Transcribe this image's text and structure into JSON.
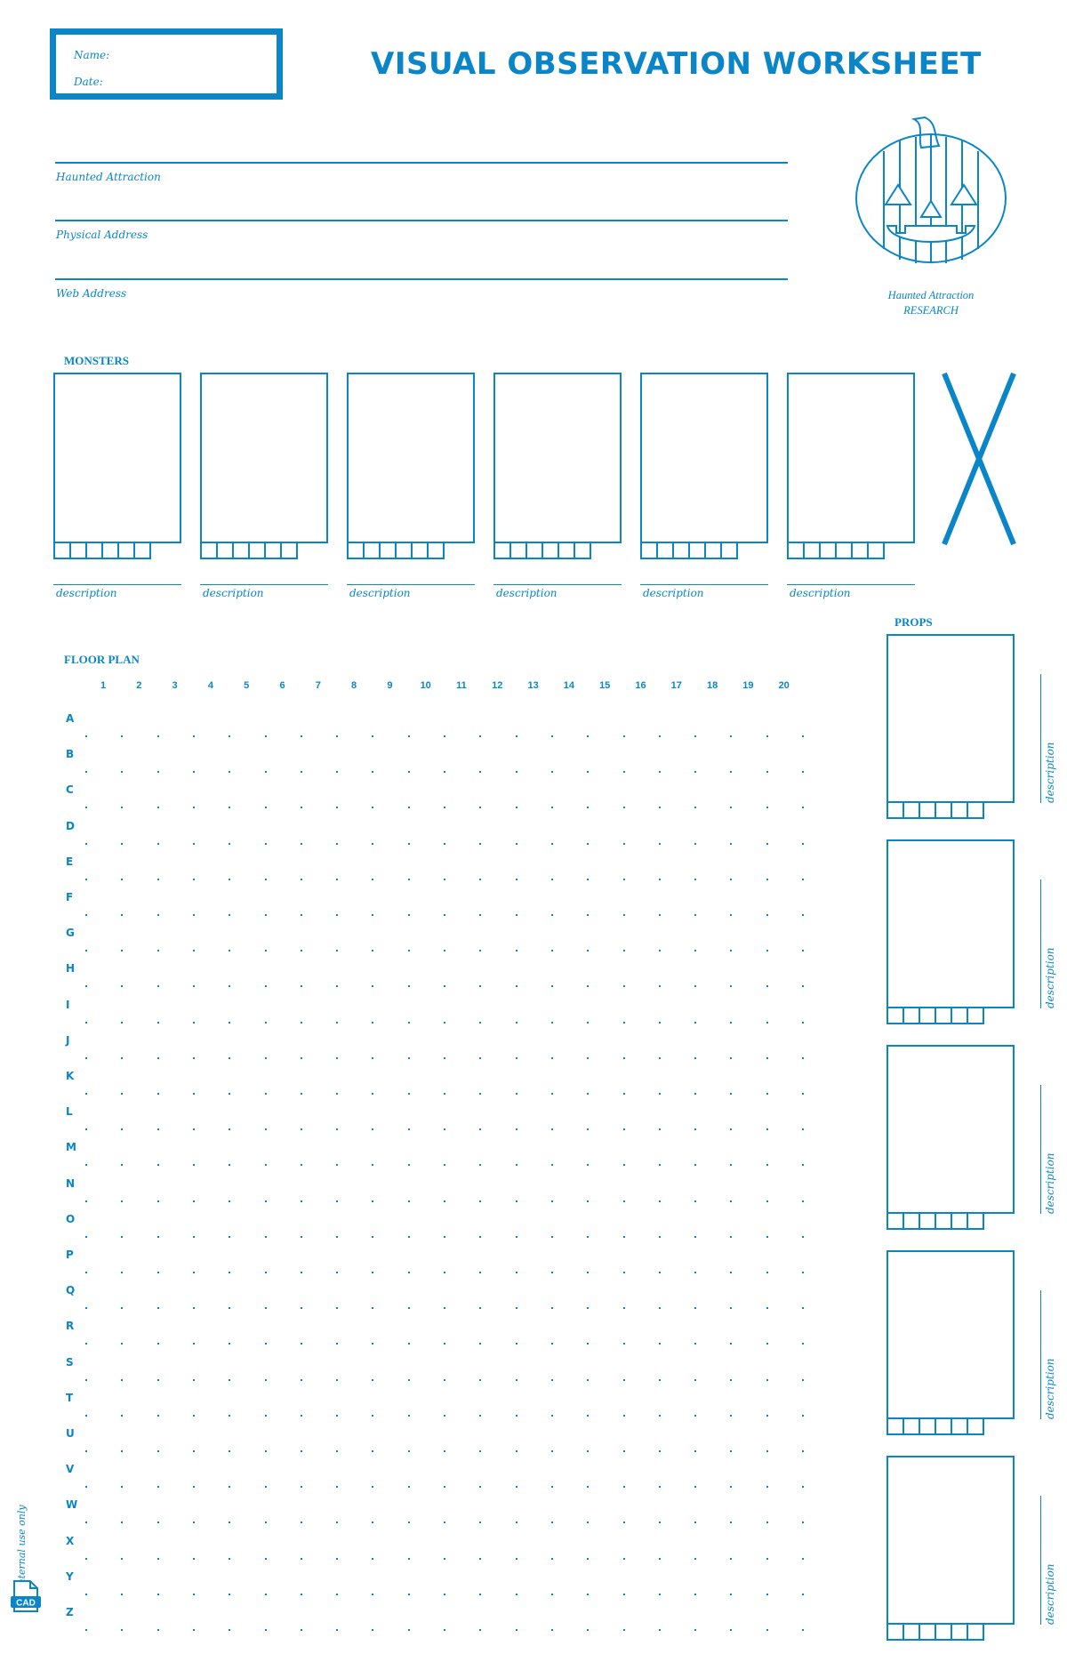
{
  "header": {
    "name_label": "Name:",
    "date_label": "Date:",
    "title": "VISUAL OBSERVATION WORKSHEET"
  },
  "fields": [
    {
      "label": "Haunted Attraction"
    },
    {
      "label": "Physical Address"
    },
    {
      "label": "Web Address"
    }
  ],
  "logo": {
    "icon": "jack-o-lantern-icon",
    "caption_line1": "Haunted Attraction",
    "caption_line2": "RESEARCH"
  },
  "monsters": {
    "label": "MONSTERS",
    "cards": [
      {
        "description_label": "description"
      },
      {
        "description_label": "description"
      },
      {
        "description_label": "description"
      },
      {
        "description_label": "description"
      },
      {
        "description_label": "description"
      },
      {
        "description_label": "description"
      }
    ],
    "tabs_per_card": 6
  },
  "props": {
    "label": "PROPS",
    "cards": [
      {
        "description_label": "description"
      },
      {
        "description_label": "description"
      },
      {
        "description_label": "description"
      },
      {
        "description_label": "description"
      },
      {
        "description_label": "description"
      }
    ]
  },
  "floor_plan": {
    "label": "FLOOR PLAN",
    "columns": [
      "1",
      "2",
      "3",
      "4",
      "5",
      "6",
      "7",
      "8",
      "9",
      "10",
      "11",
      "12",
      "13",
      "14",
      "15",
      "16",
      "17",
      "18",
      "19",
      "20"
    ],
    "rows": [
      "A",
      "B",
      "C",
      "D",
      "E",
      "F",
      "G",
      "H",
      "I",
      "J",
      "K",
      "L",
      "M",
      "N",
      "O",
      "P",
      "Q",
      "R",
      "S",
      "T",
      "U",
      "V",
      "W",
      "X",
      "Y",
      "Z"
    ]
  },
  "footer": {
    "note": "internal use only",
    "badge": "CAD"
  },
  "colors": {
    "accent": "#0a86c8"
  }
}
